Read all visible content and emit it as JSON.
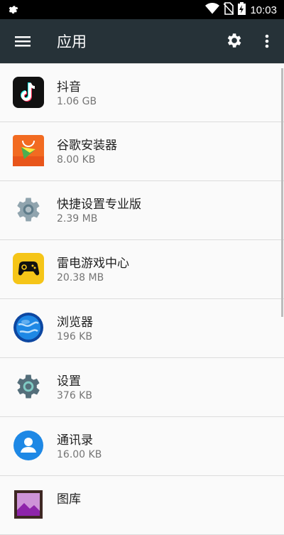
{
  "statusbar": {
    "time": "10:03",
    "icons": [
      "gear-icon",
      "wifi-icon",
      "no-sim-icon",
      "battery-charging-icon"
    ]
  },
  "appbar": {
    "title": "应用",
    "icons": [
      "menu-icon",
      "settings-icon",
      "more-vert-icon"
    ]
  },
  "apps": [
    {
      "name": "抖音",
      "size": "1.06 GB",
      "icon": "douyin-icon"
    },
    {
      "name": "谷歌安装器",
      "size": "8.00 KB",
      "icon": "google-installer-icon"
    },
    {
      "name": "快捷设置专业版",
      "size": "2.39 MB",
      "icon": "quick-settings-icon"
    },
    {
      "name": "雷电游戏中心",
      "size": "20.38 MB",
      "icon": "game-center-icon"
    },
    {
      "name": "浏览器",
      "size": "196 KB",
      "icon": "browser-icon"
    },
    {
      "name": "设置",
      "size": "376 KB",
      "icon": "settings-app-icon"
    },
    {
      "name": "通讯录",
      "size": "16.00 KB",
      "icon": "contacts-icon"
    },
    {
      "name": "图库",
      "size": "",
      "icon": "gallery-icon"
    }
  ],
  "colors": {
    "appbar": "#263238",
    "statusbar": "#000000",
    "background": "#fafafa"
  }
}
